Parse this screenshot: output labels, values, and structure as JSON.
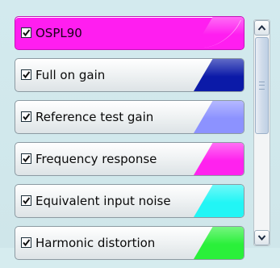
{
  "measurement_list": {
    "items": [
      {
        "label": "OSPL90",
        "checked": true,
        "selected": true,
        "color": "#ff1ef0"
      },
      {
        "label": "Full on gain",
        "checked": true,
        "selected": false,
        "color": "#0b1aa8"
      },
      {
        "label": "Reference test gain",
        "checked": true,
        "selected": false,
        "color": "#8c92ff"
      },
      {
        "label": "Frequency response",
        "checked": true,
        "selected": false,
        "color": "#ff22ee"
      },
      {
        "label": "Equivalent input noise",
        "checked": true,
        "selected": false,
        "color": "#22f5f5"
      },
      {
        "label": "Harmonic distortion",
        "checked": true,
        "selected": false,
        "color": "#2af03a"
      }
    ]
  },
  "scrollbar": {
    "up_icon": "chevron-up-icon",
    "down_icon": "chevron-down-icon",
    "thumb_icon": "grip-icon",
    "position": 0
  }
}
